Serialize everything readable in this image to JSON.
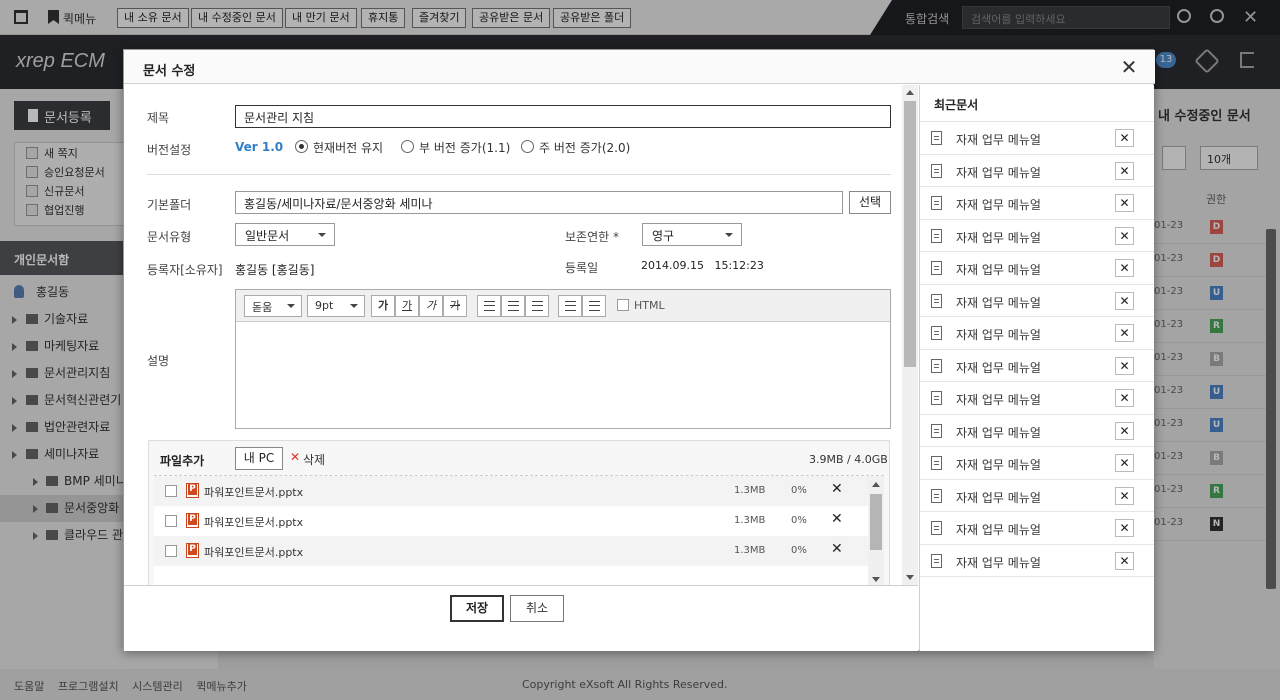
{
  "topbar": {
    "quickmenu_label": "퀵메뉴",
    "quick_buttons": [
      "내 소유 문서",
      "내 수정중인 문서",
      "내 만기 문서",
      "휴지통",
      "즐겨찾기",
      "공유받은 문서",
      "공유받은 폴더"
    ],
    "search_label": "통합검색",
    "search_placeholder": "검색어를 입력하세요"
  },
  "header": {
    "logo_text": "xrep ECM",
    "notification_count": "13"
  },
  "sidebar": {
    "register_button": "문서등록",
    "filters": [
      "새 쪽지",
      "승인요청문서",
      "신규문서",
      "협업진행"
    ],
    "section_title": "개인문서함",
    "user": "홍길동",
    "tree": [
      "기술자료",
      "마케팅자료",
      "문서관리지침",
      "문서혁신관련기",
      "법안관련자료",
      "세미나자료"
    ],
    "subtree": [
      "BMP 세미니",
      "문서중앙화",
      "클라우드 관"
    ]
  },
  "right_panel": {
    "title": "내 수정중인 문서",
    "page_size": "10개",
    "perm_header": "권한",
    "rows": [
      {
        "date": "01-23",
        "perm": "D",
        "color": "#d8605a"
      },
      {
        "date": "01-23",
        "perm": "D",
        "color": "#d8605a"
      },
      {
        "date": "01-23",
        "perm": "U",
        "color": "#4b84c6"
      },
      {
        "date": "01-23",
        "perm": "R",
        "color": "#4aa55a"
      },
      {
        "date": "01-23",
        "perm": "B",
        "color": "#aaaaaa"
      },
      {
        "date": "01-23",
        "perm": "U",
        "color": "#4b84c6"
      },
      {
        "date": "01-23",
        "perm": "U",
        "color": "#4b84c6"
      },
      {
        "date": "01-23",
        "perm": "B",
        "color": "#aaaaaa"
      },
      {
        "date": "01-23",
        "perm": "R",
        "color": "#4aa55a"
      },
      {
        "date": "01-23",
        "perm": "N",
        "color": "#333333"
      }
    ]
  },
  "footer": {
    "links": [
      "도움말",
      "프로그램설치",
      "시스템관리",
      "퀵메뉴추가"
    ],
    "copyright": "Copyright eXsoft All Rights Reserved."
  },
  "modal": {
    "title": "문서 수정",
    "labels": {
      "title": "제목",
      "version": "버전설정",
      "folder": "기본폴더",
      "doc_type": "문서유형",
      "owner": "등록자[소유자]",
      "retention": "보존연한 *",
      "reg_date": "등록일",
      "description": "설명"
    },
    "title_value": "문서관리 지침",
    "version_value": "Ver 1.0",
    "version_options": [
      "현재버전 유지",
      "부 버전 증가(1.1)",
      "주 버전 증가(2.0)"
    ],
    "folder_value": "홍길동/세미나자료/문서중앙화 세미나",
    "folder_button": "선택",
    "doc_type_value": "일반문서",
    "retention_value": "영구",
    "owner_value": "홍길동 [홍길동]",
    "reg_date_value": "2014.09.15   15:12:23",
    "editor": {
      "font": "돋움",
      "size": "9pt",
      "bold": "가",
      "underline": "가",
      "italic": "가",
      "strike": "가",
      "html_label": "HTML"
    },
    "files": {
      "title": "파일추가",
      "add_button": "내 PC",
      "delete_button": "삭제",
      "usage": "3.9MB / 4.0GB",
      "items": [
        {
          "name": "파워포인트문서.pptx",
          "size": "1.3MB",
          "progress": "0%"
        },
        {
          "name": "파워포인트문서.pptx",
          "size": "1.3MB",
          "progress": "0%"
        },
        {
          "name": "파워포인트문서.pptx",
          "size": "1.3MB",
          "progress": "0%"
        }
      ]
    },
    "save_button": "저장",
    "cancel_button": "취소",
    "recent": {
      "title": "최근문서",
      "items": [
        "자재 업무 메뉴얼",
        "자재 업무 메뉴얼",
        "자재 업무 메뉴얼",
        "자재 업무 메뉴얼",
        "자재 업무 메뉴얼",
        "자재 업무 메뉴얼",
        "자재 업무 메뉴얼",
        "자재 업무 메뉴얼",
        "자재 업무 메뉴얼",
        "자재 업무 메뉴얼",
        "자재 업무 메뉴얼",
        "자재 업무 메뉴얼",
        "자재 업무 메뉴얼",
        "자재 업무 메뉴얼"
      ]
    }
  }
}
